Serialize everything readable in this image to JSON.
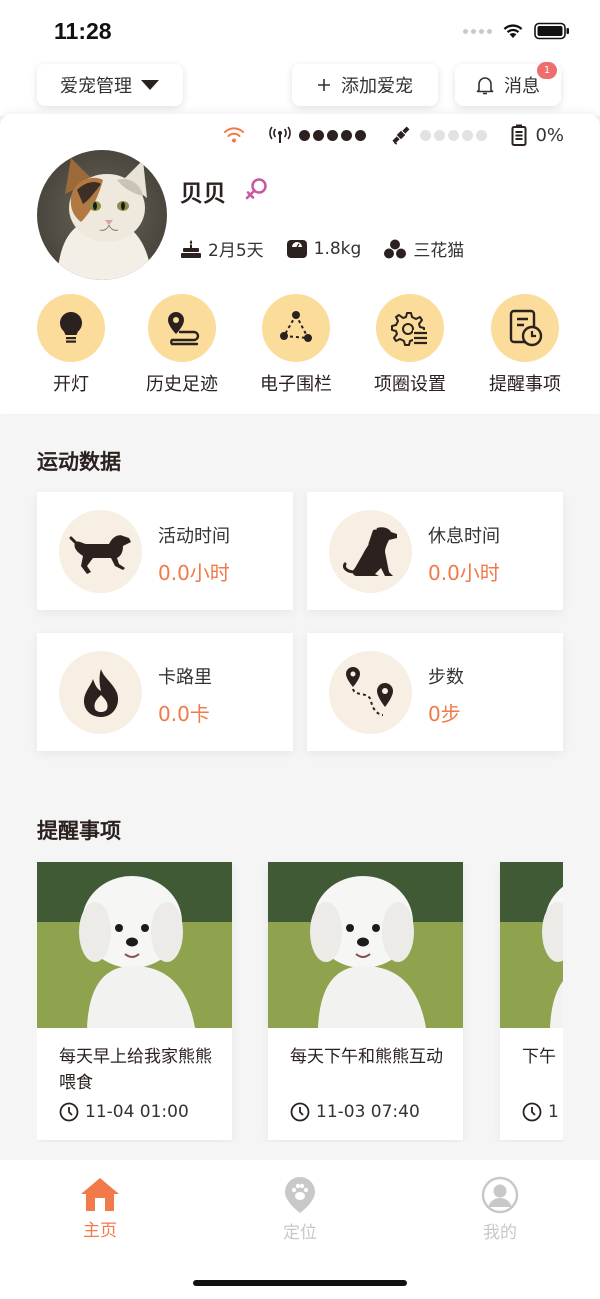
{
  "status_bar": {
    "time": "11:28"
  },
  "header": {
    "pet_manage_label": "爱宠管理",
    "add_pet_label": "添加爱宠",
    "messages_label": "消息",
    "messages_badge": "1"
  },
  "device": {
    "battery": "0%"
  },
  "pet": {
    "name": "贝贝",
    "age": "2月5天",
    "weight": "1.8kg",
    "breed": "三花猫"
  },
  "actions": [
    {
      "label": "开灯",
      "icon": "lightbulb-icon"
    },
    {
      "label": "历史足迹",
      "icon": "location-track-icon"
    },
    {
      "label": "电子围栏",
      "icon": "geo-fence-icon"
    },
    {
      "label": "项圈设置",
      "icon": "gear-settings-icon"
    },
    {
      "label": "提醒事项",
      "icon": "reminder-clock-icon"
    }
  ],
  "exercise": {
    "title": "运动数据",
    "stats": [
      {
        "label": "活动时间",
        "value": "0.0小时",
        "icon": "running-dog-icon"
      },
      {
        "label": "休息时间",
        "value": "0.0小时",
        "icon": "sitting-dog-icon"
      },
      {
        "label": "卡路里",
        "value": "0.0卡",
        "icon": "flame-icon"
      },
      {
        "label": "步数",
        "value": "0步",
        "icon": "route-pins-icon"
      }
    ]
  },
  "reminders": {
    "title": "提醒事项",
    "items": [
      {
        "text": "每天早上给我家熊熊喂食",
        "time": "11-04 01:00"
      },
      {
        "text": "每天下午和熊熊互动",
        "time": "11-03 07:40"
      },
      {
        "text": "下午",
        "time": "1"
      }
    ]
  },
  "tabs": [
    {
      "label": "主页",
      "active": true
    },
    {
      "label": "定位",
      "active": false
    },
    {
      "label": "我的",
      "active": false
    }
  ],
  "colors": {
    "accent": "#f07a4a",
    "action_circle": "#fbdc9a",
    "stat_circle": "#f7efe3",
    "icon_dark": "#2b2220",
    "female": "#c9569f",
    "badge": "#ee6d6d",
    "inactive_tab": "#c8c8c8"
  }
}
